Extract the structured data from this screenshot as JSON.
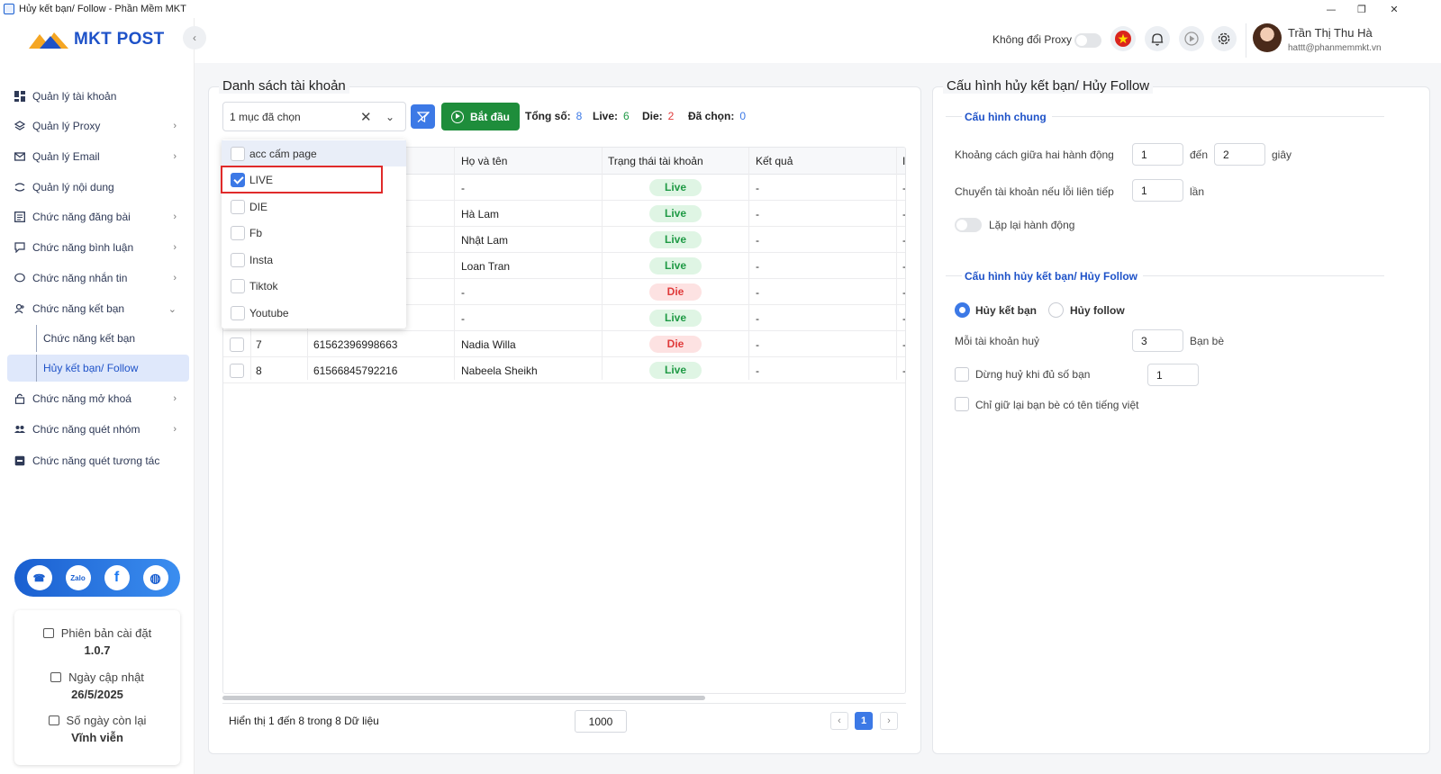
{
  "window": {
    "title": "Hủy kết bạn/ Follow - Phần Mềm MKT"
  },
  "brand": {
    "name": "MKT POST"
  },
  "sidebar": {
    "items": [
      {
        "label": "Quản lý tài khoản"
      },
      {
        "label": "Quản lý Proxy"
      },
      {
        "label": "Quản lý Email"
      },
      {
        "label": "Quản lý nội dung"
      },
      {
        "label": "Chức năng đăng bài"
      },
      {
        "label": "Chức năng bình luận"
      },
      {
        "label": "Chức năng nhắn tin"
      },
      {
        "label": "Chức năng kết bạn"
      },
      {
        "label": "Chức năng mở khoá"
      },
      {
        "label": "Chức năng quét nhóm"
      },
      {
        "label": "Chức năng quét tương tác"
      }
    ],
    "sub_items": [
      {
        "label": "Chức năng kết bạn"
      },
      {
        "label": "Hủy kết bạn/ Follow"
      }
    ],
    "info": {
      "version_label": "Phiên bản cài đặt",
      "version_value": "1.0.7",
      "update_label": "Ngày cập nhật",
      "update_value": "26/5/2025",
      "days_label": "Số ngày còn lại",
      "days_value": "Vĩnh viễn"
    }
  },
  "topbar": {
    "proxy_label": "Không đổi Proxy",
    "user_name": "Trần Thị Thu Hà",
    "user_email": "hattt@phanmemmkt.vn"
  },
  "accounts": {
    "title": "Danh sách tài khoản",
    "filter_value": "1 mục đã chọn",
    "start_label": "Bắt đầu",
    "total_label": "Tổng số:",
    "total_value": "8",
    "live_label": "Live:",
    "live_value": "6",
    "die_label": "Die:",
    "die_value": "2",
    "selected_label": "Đã chọn:",
    "selected_value": "0",
    "columns": [
      "Họ và tên",
      "Trạng thái tài khoản",
      "Kết quả",
      "I"
    ],
    "rows": [
      {
        "no": "",
        "uid": "",
        "name": "-",
        "status": "Live",
        "result": "-",
        "extra": "-"
      },
      {
        "no": "",
        "uid": "",
        "name": "Hà Lam",
        "status": "Live",
        "result": "-",
        "extra": "-"
      },
      {
        "no": "",
        "uid": "",
        "name": "Nhật Lam",
        "status": "Live",
        "result": "-",
        "extra": "-"
      },
      {
        "no": "",
        "uid": "",
        "name": "Loan Tran",
        "status": "Live",
        "result": "-",
        "extra": "-"
      },
      {
        "no": "",
        "uid": "",
        "name": "-",
        "status": "Die",
        "result": "-",
        "extra": "-"
      },
      {
        "no": "",
        "uid": "",
        "name": "-",
        "status": "Live",
        "result": "-",
        "extra": "-"
      },
      {
        "no": "7",
        "uid": "61562396998663",
        "name": "Nadia Willa",
        "status": "Die",
        "result": "-",
        "extra": "-"
      },
      {
        "no": "8",
        "uid": "61566845792216",
        "name": "Nabeela Sheikh",
        "status": "Live",
        "result": "-",
        "extra": "-"
      }
    ],
    "dropdown": [
      {
        "label": "acc cấm page",
        "checked": false
      },
      {
        "label": "LIVE",
        "checked": true
      },
      {
        "label": "DIE",
        "checked": false
      },
      {
        "label": "Fb",
        "checked": false
      },
      {
        "label": "Insta",
        "checked": false
      },
      {
        "label": "Tiktok",
        "checked": false
      },
      {
        "label": "Youtube",
        "checked": false
      }
    ],
    "footer_text": "Hiển thị 1 đến 8 trong 8 Dữ liệu",
    "page_size": "1000",
    "current_page": "1"
  },
  "config": {
    "title": "Cấu hình hủy kết bạn/ Hủy Follow",
    "general_title": "Cấu hình chung",
    "interval_label": "Khoảng cách giữa hai hành động",
    "interval_from": "1",
    "interval_to_label": "đến",
    "interval_to": "2",
    "interval_unit": "giây",
    "switch_label": "Chuyển tài khoản nếu lỗi liên tiếp",
    "switch_value": "1",
    "switch_unit": "lần",
    "repeat_label": "Lặp lại hành động",
    "section2_title": "Cấu hình hủy kết bạn/ Hủy Follow",
    "radio_unfriend": "Hủy kết bạn",
    "radio_unfollow": "Hủy follow",
    "per_account_label": "Mỗi tài khoản huỷ",
    "per_account_value": "3",
    "per_account_unit": "Bạn bè",
    "stop_label": "Dừng huỷ khi đủ số bạn",
    "stop_value": "1",
    "keep_vn_label": "Chỉ giữ lại bạn bè có tên tiếng việt"
  },
  "colors": {
    "accent": "#3c79e6",
    "start_green": "#1e8d3b",
    "live": "#1f9a45",
    "die": "#e03a3a"
  }
}
